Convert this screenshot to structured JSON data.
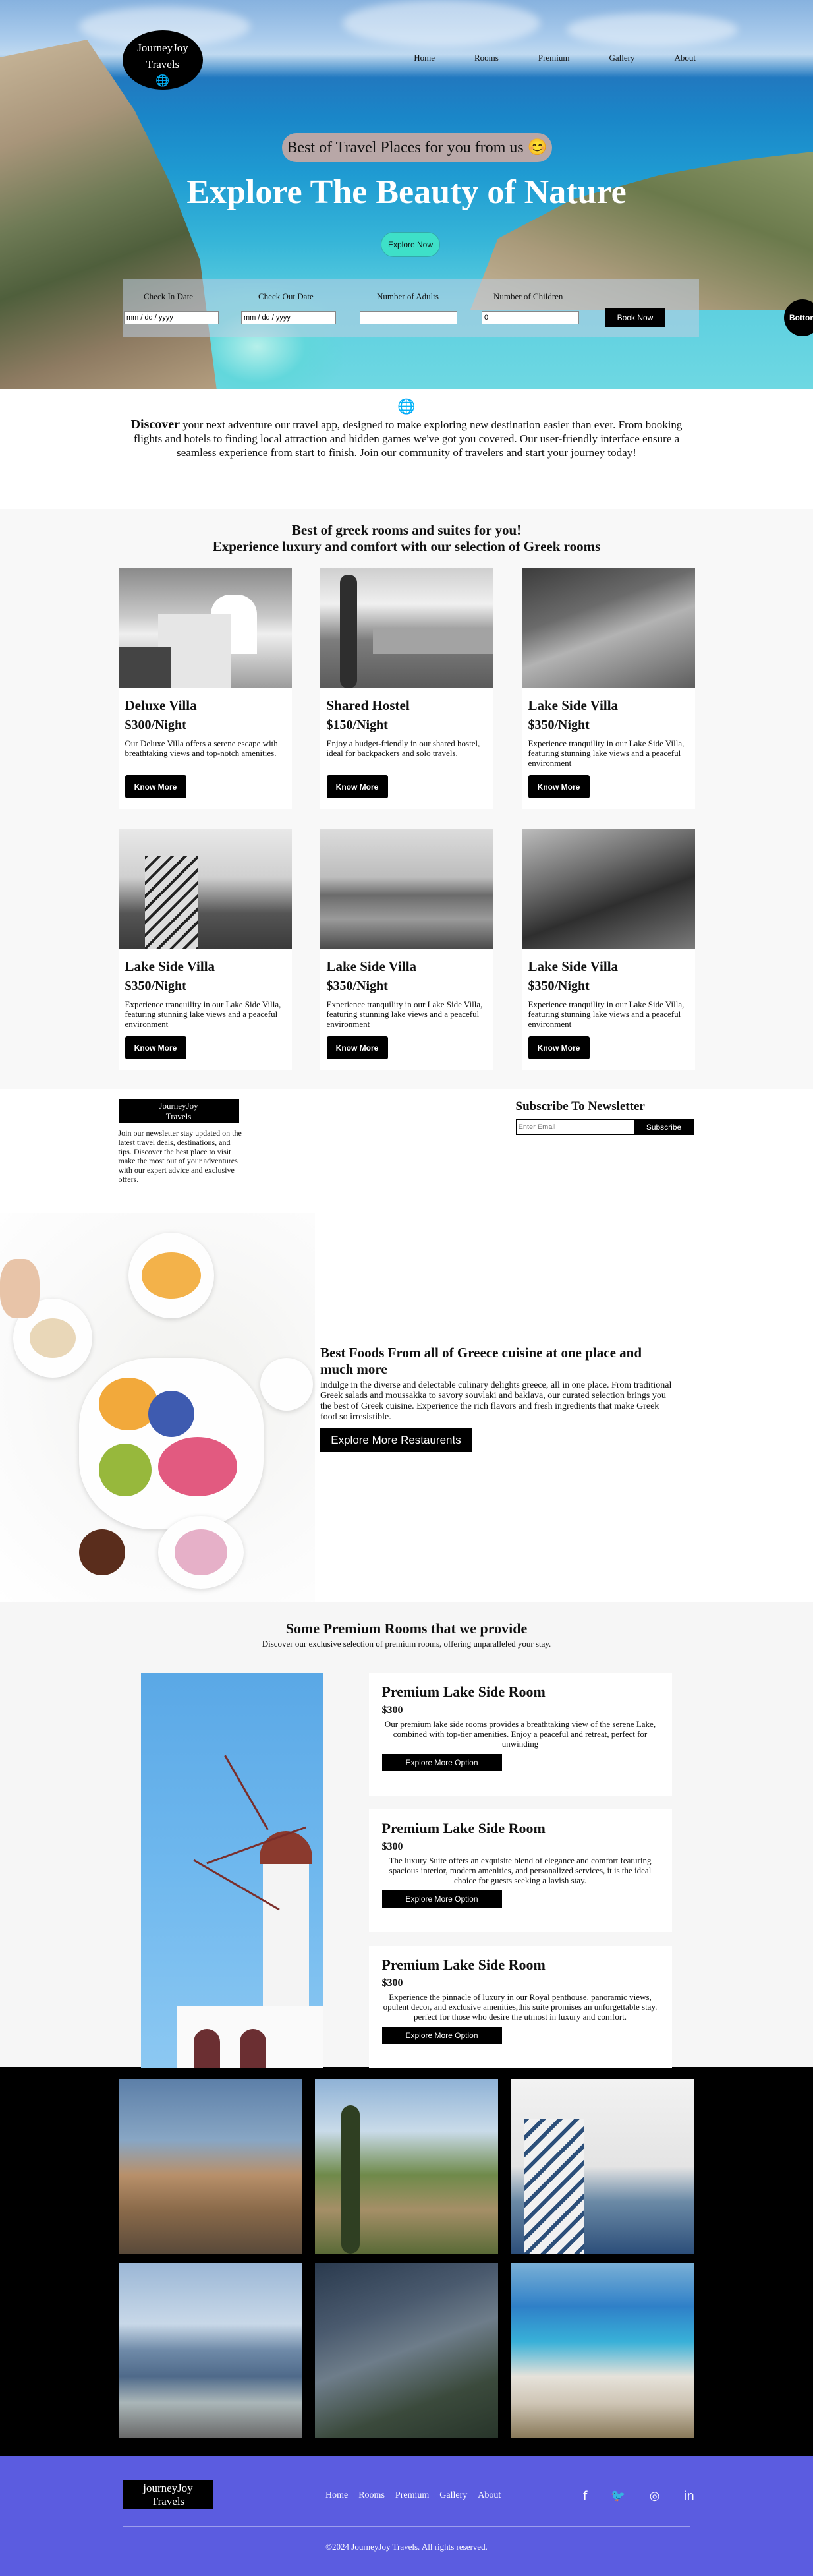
{
  "brand": {
    "line1": "JourneyJoy",
    "line2": "Travels",
    "icon": "globe-icon"
  },
  "nav": [
    "Home",
    "Rooms",
    "Premium",
    "Gallery",
    "About"
  ],
  "hero": {
    "pill": "Best of Travel Places for you from us 😊",
    "title": "Explore The Beauty of Nature",
    "explore": "Explore Now",
    "to_bottom": "Bottom"
  },
  "booking": {
    "check_in": "Check In Date",
    "check_out": "Check Out Date",
    "adults": "Number of Adults",
    "children": "Number of Children",
    "date_placeholder": "mm / dd / yyyy",
    "num_value": "0",
    "book": "Book Now"
  },
  "intro": {
    "lead": "Discover",
    "text": " your next adventure our travel app, designed to make exploring new destination easier than ever. From booking flights and hotels to finding local attraction and hidden games we've got you covered. Our user-friendly interface ensure a seamless experience from start to finish. Join our community of travelers and start your journey today!"
  },
  "rooms": {
    "title1": "Best of greek rooms and suites for you!",
    "title2": "Experience luxury and comfort with our selection of Greek rooms",
    "cards": [
      {
        "name": "Deluxe Villa",
        "price": "$300/Night",
        "desc": "Our Deluxe Villa offers a serene escape with breathtaking views and top-notch amenities.",
        "btn": "Know More"
      },
      {
        "name": "Shared Hostel",
        "price": "$150/Night",
        "desc": "Enjoy a budget-friendly in our shared hostel, ideal for backpackers and solo travels.",
        "btn": "Know More"
      },
      {
        "name": "Lake Side Villa",
        "price": "$350/Night",
        "desc": "Experience tranquility in our Lake Side Villa, featuring stunning lake views and a peaceful environment",
        "btn": "Know More"
      },
      {
        "name": "Lake Side Villa",
        "price": "$350/Night",
        "desc": "Experience tranquility in our Lake Side Villa, featuring stunning lake views and a peaceful environment",
        "btn": "Know More"
      },
      {
        "name": "Lake Side Villa",
        "price": "$350/Night",
        "desc": "Experience tranquility in our Lake Side Villa, featuring stunning lake views and a peaceful environment",
        "btn": "Know More"
      },
      {
        "name": "Lake Side Villa",
        "price": "$350/Night",
        "desc": "Experience tranquility in our Lake Side Villa, featuring stunning lake views and a peaceful environment",
        "btn": "Know More"
      }
    ]
  },
  "newsletter": {
    "logo1": "JourneyJoy",
    "logo2": "Travels",
    "text": "Join our newsletter stay updated on the latest travel deals, destinations, and tips. Discover the best place to visit make the most out of your adventures with our expert advice and exclusive offers.",
    "title": "Subscribe To Newsletter",
    "placeholder": "Enter Email",
    "btn": "Subscribe"
  },
  "food": {
    "title": "Best Foods From all of Greece cuisine at one place and much more",
    "text": "Indulge in the diverse and delectable culinary delights greece, all in one place. From traditional Greek salads and moussakka to savory souvlaki and baklava, our curated selection brings you the best of Greek cuisine. Experience the rich flavors and fresh ingredients that make Greek food so irresistible.",
    "btn": "Explore More Restaurents"
  },
  "premium": {
    "title": "Some Premium Rooms that we provide",
    "subtitle": "Discover our exclusive selection of premium rooms, offering unparalleled your stay.",
    "cards": [
      {
        "name": "Premium Lake Side Room",
        "price": "$300",
        "desc": "Our premium lake side rooms provides a breathtaking view of the serene Lake, combined with top-tier amenities. Enjoy a peaceful and retreat, perfect for unwinding",
        "btn": "Explore More Option"
      },
      {
        "name": "Premium Lake Side Room",
        "price": "$300",
        "desc": "The luxury Suite offers an exquisite blend of elegance and comfort featuring spacious interior, modern amenities, and personalized services, it is the ideal choice for guests seeking a lavish stay.",
        "btn": "Explore More Option"
      },
      {
        "name": "Premium Lake Side Room",
        "price": "$300",
        "desc": "Experience the pinnacle of luxury in our Royal penthouse. panoramic views, opulent decor, and exclusive amenities,this suite promises an unforgettable stay. perfect for those who desire the utmost in luxury and comfort.",
        "btn": "Explore More Option"
      }
    ]
  },
  "footer": {
    "logo1": "journeyJoy",
    "logo2": "Travels",
    "nav": [
      "Home",
      "Rooms",
      "Premium",
      "Gallery",
      "About"
    ],
    "social": [
      "facebook-icon",
      "twitter-icon",
      "instagram-icon",
      "linkedin-icon"
    ],
    "copyright": "©2024 JourneyJoy Travels. All rights reserved."
  }
}
